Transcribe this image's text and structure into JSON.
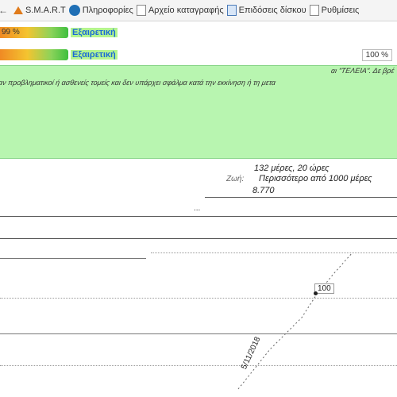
{
  "bookmarks": [
    {
      "label": "S.M.A.R.T",
      "icon": "smart-logo-icon"
    },
    {
      "label": "Πληροφορίες",
      "icon": "info-circle-icon"
    },
    {
      "label": "Αρχείο καταγραφής",
      "icon": "page-icon"
    },
    {
      "label": "Επιδόσεις δίσκου",
      "icon": "disk-page-icon"
    },
    {
      "label": "Ρυθμίσεις",
      "icon": "page-icon"
    }
  ],
  "status_rows": [
    {
      "bar_value": "99 %",
      "bar_fraction": 0.86,
      "rating": "Εξαιρετική",
      "percent": ""
    },
    {
      "bar_value": "",
      "bar_fraction": 0.86,
      "rating": "Εξαιρετική",
      "percent": "100 %"
    }
  ],
  "info_panel": {
    "line1": "αι \"ΤΕΛΕΙΑ\". Δε βρέ",
    "line2": "αν προβληματικοί ή ασθενείς τομείς και δεν υπάρχει σφάλμα κατά την εκκίνηση ή τη μετα"
  },
  "stats": {
    "duration": "132 μέρες, 20 ώρες",
    "remaining_label": "Ζωή:",
    "remaining": "Περισσότερο από 1000 μέρες",
    "value": "8.770"
  },
  "graph": {
    "ellipsis": "...",
    "point_value": "100",
    "date_label": "5/11/2018"
  }
}
